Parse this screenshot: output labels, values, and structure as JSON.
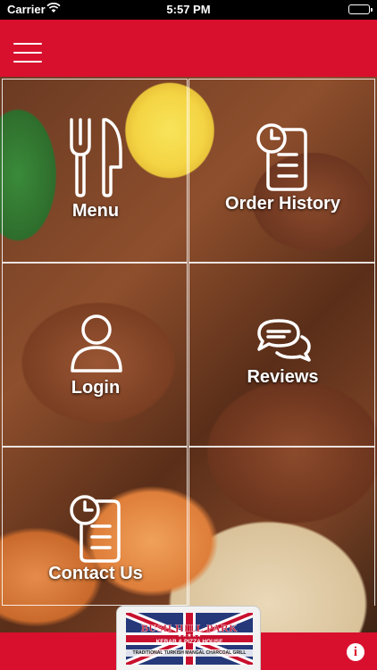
{
  "status_bar": {
    "carrier": "Carrier",
    "time": "5:57 PM"
  },
  "header": {
    "menu_icon": "hamburger-icon",
    "background": "#d8102e"
  },
  "tiles": [
    {
      "label": "Menu",
      "icon": "fork-knife-icon"
    },
    {
      "label": "Order History",
      "icon": "order-history-icon"
    },
    {
      "label": "Login",
      "icon": "user-icon"
    },
    {
      "label": "Reviews",
      "icon": "chat-bubbles-icon"
    },
    {
      "label": "Contact Us",
      "icon": "contact-icon"
    }
  ],
  "footer": {
    "logo": {
      "name": "BUSH HILL PARK",
      "subtitle": "KEBAB & PIZZA HOUSE",
      "tagline": "TRADITIONAL TURKISH MANGAL CHARCOAL GRILL"
    },
    "info_icon": "info-icon"
  },
  "colors": {
    "brand": "#d8102e"
  }
}
